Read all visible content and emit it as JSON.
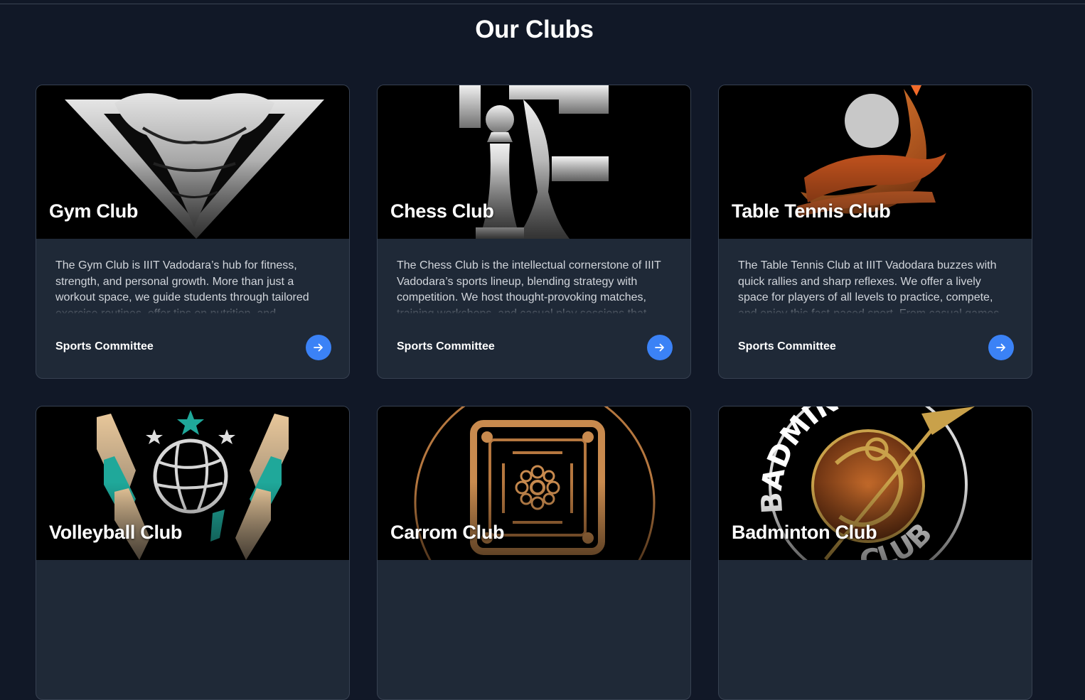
{
  "page": {
    "title": "Our Clubs"
  },
  "clubs": [
    {
      "name": "Gym Club",
      "description": "The Gym Club is IIIT Vadodara’s hub for fitness, strength, and personal growth. More than just a workout space, we guide students through tailored exercise routines, offer tips on nutrition, and",
      "committee": "Sports Committee",
      "icon": "gym-logo-icon"
    },
    {
      "name": "Chess Club",
      "description": "The Chess Club is the intellectual cornerstone of IIIT Vadodara’s sports lineup, blending strategy with competition. We host thought-provoking matches, training workshops, and casual play sessions that",
      "committee": "Sports Committee",
      "icon": "chess-logo-icon"
    },
    {
      "name": "Table Tennis Club",
      "description": "The Table Tennis Club at IIIT Vadodara buzzes with quick rallies and sharp reflexes. We offer a lively space for players of all levels to practice, compete, and enjoy this fast-paced sport. From casual games",
      "committee": "Sports Committee",
      "icon": "table-tennis-logo-icon"
    },
    {
      "name": "Volleyball Club",
      "description": "",
      "committee": "",
      "icon": "volleyball-logo-icon"
    },
    {
      "name": "Carrom Club",
      "description": "",
      "committee": "",
      "icon": "carrom-logo-icon"
    },
    {
      "name": "Badminton Club",
      "description": "",
      "committee": "",
      "icon": "badminton-logo-icon",
      "logo_text": {
        "top": "BADMINTON",
        "bottom": "CLUB"
      }
    }
  ],
  "colors": {
    "background": "#111827",
    "card": "#1f2937",
    "accent": "#3b82f6",
    "text_muted": "#d1d5db"
  }
}
